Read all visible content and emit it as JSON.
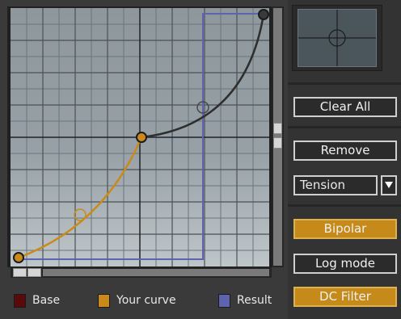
{
  "legend": {
    "base": {
      "label": "Base",
      "color": "#5a0a0a"
    },
    "your_curve": {
      "label": "Your curve",
      "color": "#c98a1a"
    },
    "result": {
      "label": "Result",
      "color": "#5e63b0"
    }
  },
  "buttons": {
    "clear_all": "Clear All",
    "remove": "Remove",
    "bipolar": "Bipolar",
    "log_mode": "Log mode",
    "dc_filter": "DC Filter"
  },
  "tension_dropdown": {
    "selected": "Tension"
  },
  "toggles": {
    "bipolar_active": true,
    "log_mode_active": false,
    "dc_filter_active": true
  },
  "colors": {
    "graph_bg": "#8f9aa0",
    "grid": "#4a5055",
    "axis": "#1f2326",
    "curve_lower": "#c98a1a",
    "curve_upper": "#2e2e2e",
    "result": "#5e63b0"
  },
  "icons": {
    "dropdown_arrow": "chevron-down-icon"
  }
}
